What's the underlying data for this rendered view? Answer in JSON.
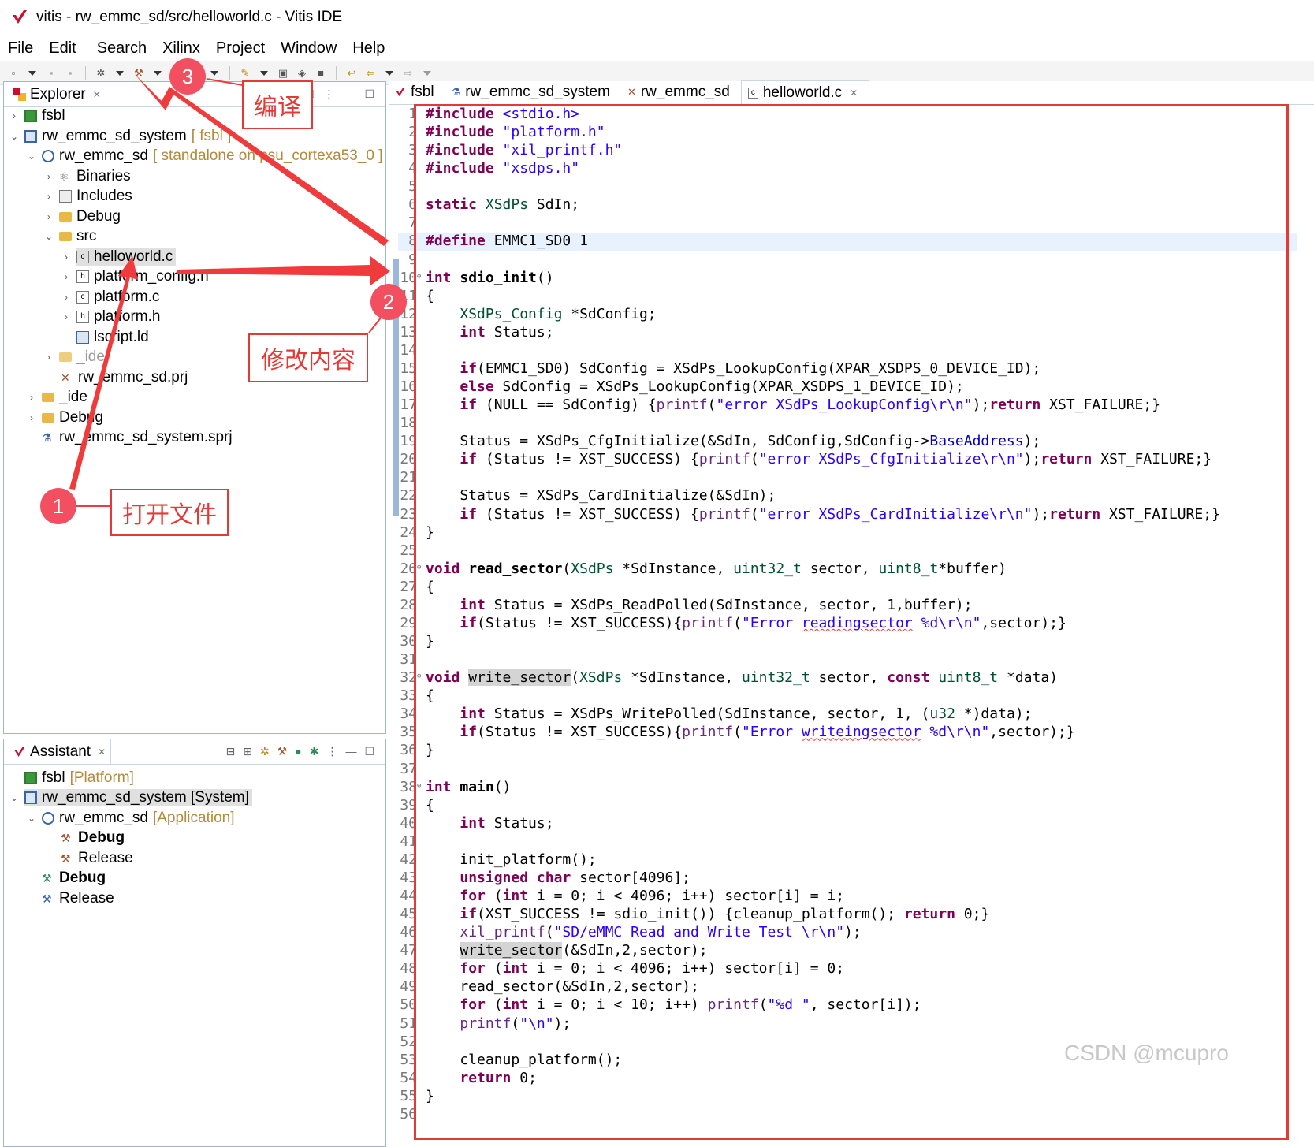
{
  "window": {
    "title": "vitis - rw_emmc_sd/src/helloworld.c - Vitis IDE"
  },
  "menu": [
    "File",
    "Edit",
    "Search",
    "Xilinx",
    "Project",
    "Window",
    "Help"
  ],
  "explorer": {
    "tab_label": "Explorer",
    "items": [
      {
        "label": "fsbl",
        "icon": "platform-icon",
        "expanded": false
      },
      {
        "label": "rw_emmc_sd_system",
        "decoration": "[ fsbl ]",
        "icon": "system-project-icon",
        "expanded": true
      },
      {
        "label": "rw_emmc_sd",
        "decoration": "[ standalone on psu_cortexa53_0 ]",
        "icon": "application-project-icon",
        "expanded": true
      },
      {
        "label": "Binaries",
        "icon": "binaries-icon",
        "expanded": false
      },
      {
        "label": "Includes",
        "icon": "includes-icon",
        "expanded": false
      },
      {
        "label": "Debug",
        "icon": "folder-icon",
        "expanded": false
      },
      {
        "label": "src",
        "icon": "folder-icon",
        "expanded": true
      },
      {
        "label": "helloworld.c",
        "icon": "c-file-icon",
        "selected": true
      },
      {
        "label": "platform_config.h",
        "icon": "h-file-icon"
      },
      {
        "label": "platform.c",
        "icon": "c-file-icon"
      },
      {
        "label": "platform.h",
        "icon": "h-file-icon"
      },
      {
        "label": "lscript.ld",
        "icon": "ld-file-icon"
      },
      {
        "label": "_ide",
        "icon": "folder-icon"
      },
      {
        "label": "rw_emmc_sd.prj",
        "icon": "prj-file-icon"
      },
      {
        "label": "_ide",
        "icon": "folder-icon"
      },
      {
        "label": "Debug",
        "icon": "folder-icon"
      },
      {
        "label": "rw_emmc_sd_system.sprj",
        "icon": "sprj-file-icon"
      }
    ]
  },
  "assistant": {
    "tab_label": "Assistant",
    "items": [
      {
        "label": "fsbl",
        "decoration": "[Platform]"
      },
      {
        "label": "rw_emmc_sd_system [System]",
        "decoration": ""
      },
      {
        "label": "rw_emmc_sd",
        "decoration": "[Application]"
      },
      {
        "label": "Debug",
        "bold": true
      },
      {
        "label": "Release"
      },
      {
        "label": "Debug",
        "bold": true
      },
      {
        "label": "Release"
      }
    ]
  },
  "editor_tabs": [
    {
      "label": "fsbl",
      "active": false
    },
    {
      "label": "rw_emmc_sd_system",
      "active": false
    },
    {
      "label": "rw_emmc_sd",
      "active": false
    },
    {
      "label": "helloworld.c",
      "active": true
    }
  ],
  "code_lines": [
    "#include <stdio.h>",
    "#include \"platform.h\"",
    "#include \"xil_printf.h\"",
    "#include \"xsdps.h\"",
    "",
    "static XSdPs SdIn;",
    "",
    "#define EMMC1_SD0 1",
    "",
    "int sdio_init()",
    "{",
    "    XSdPs_Config *SdConfig;",
    "    int Status;",
    "",
    "    if(EMMC1_SD0) SdConfig = XSdPs_LookupConfig(XPAR_XSDPS_0_DEVICE_ID);",
    "    else SdConfig = XSdPs_LookupConfig(XPAR_XSDPS_1_DEVICE_ID);",
    "    if (NULL == SdConfig) {printf(\"error XSdPs_LookupConfig\\r\\n\");return XST_FAILURE;}",
    "",
    "    Status = XSdPs_CfgInitialize(&SdIn, SdConfig,SdConfig->BaseAddress);",
    "    if (Status != XST_SUCCESS) {printf(\"error XSdPs_CfgInitialize\\r\\n\");return XST_FAILURE;}",
    "",
    "    Status = XSdPs_CardInitialize(&SdIn);",
    "    if (Status != XST_SUCCESS) {printf(\"error XSdPs_CardInitialize\\r\\n\");return XST_FAILURE;}",
    "}",
    "",
    "void read_sector(XSdPs *SdInstance, uint32_t sector, uint8_t*buffer)",
    "{",
    "    int Status = XSdPs_ReadPolled(SdInstance, sector, 1,buffer);",
    "    if(Status != XST_SUCCESS){printf(\"Error readingsector %d\\r\\n\",sector);}",
    "}",
    "",
    "void write_sector(XSdPs *SdInstance, uint32_t sector, const uint8_t *data)",
    "{",
    "    int Status = XSdPs_WritePolled(SdInstance, sector, 1, (u32 *)data);",
    "    if(Status != XST_SUCCESS){printf(\"Error writeingsector %d\\r\\n\",sector);}",
    "}",
    "",
    "int main()",
    "{",
    "    int Status;",
    "",
    "    init_platform();",
    "    unsigned char sector[4096];",
    "    for (int i = 0; i < 4096; i++) sector[i] = i;",
    "    if(XST_SUCCESS != sdio_init()) {cleanup_platform(); return 0;}",
    "    xil_printf(\"SD/eMMC Read and Write Test \\r\\n\");",
    "    write_sector(&SdIn,2,sector);",
    "    for (int i = 0; i < 4096; i++) sector[i] = 0;",
    "    read_sector(&SdIn,2,sector);",
    "    for (int i = 0; i < 10; i++) printf(\"%d \", sector[i]);",
    "    printf(\"\\n\");",
    "",
    "    cleanup_platform();",
    "    return 0;",
    "}",
    ""
  ],
  "annotations": {
    "step1": {
      "number": "1",
      "label": "打开文件"
    },
    "step2": {
      "number": "2",
      "label": "修改内容"
    },
    "step3": {
      "number": "3",
      "label": "编译"
    }
  },
  "watermark": "CSDN @mcupro",
  "colors": {
    "annotation": "#e53935",
    "keyword": "#7f0055",
    "string": "#2a00ff"
  }
}
